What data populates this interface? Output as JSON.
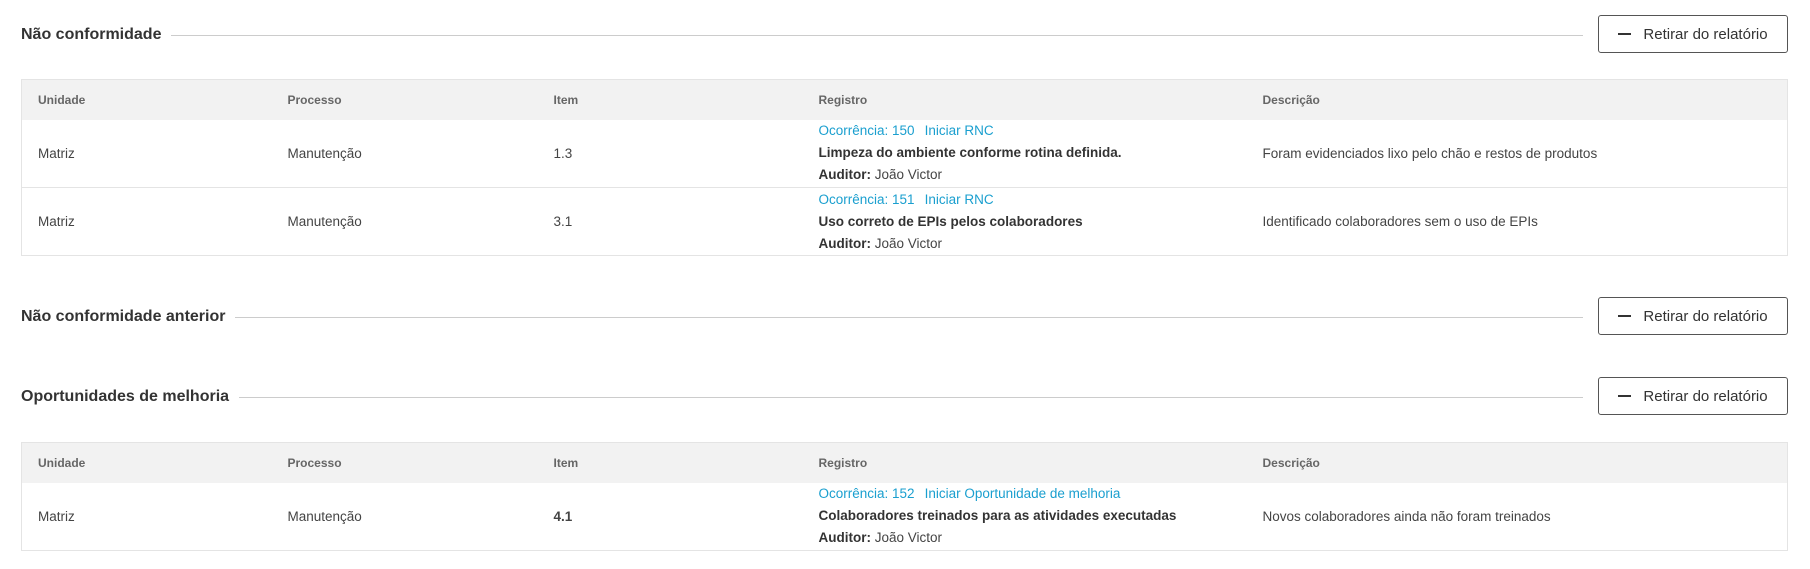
{
  "sections": {
    "nc": {
      "title": "Não conformidade",
      "remove_label": "Retirar do relatório"
    },
    "nc_prev": {
      "title": "Não conformidade anterior",
      "remove_label": "Retirar do relatório"
    },
    "om": {
      "title": "Oportunidades de melhoria",
      "remove_label": "Retirar do relatório"
    }
  },
  "columns": {
    "unidade": "Unidade",
    "processo": "Processo",
    "item": "Item",
    "registro": "Registro",
    "descricao": "Descrição"
  },
  "nc_rows": [
    {
      "unidade": "Matriz",
      "processo": "Manutenção",
      "item": "1.3",
      "occurrence": "Ocorrência: 150",
      "action": "Iniciar RNC",
      "title": "Limpeza do ambiente conforme rotina definida.",
      "auditor_label": "Auditor:",
      "auditor": " João Victor",
      "descricao": "Foram evidenciados lixo pelo chão e restos de produtos"
    },
    {
      "unidade": "Matriz",
      "processo": "Manutenção",
      "item": "3.1",
      "occurrence": "Ocorrência: 151",
      "action": "Iniciar RNC",
      "title": "Uso correto de EPIs pelos colaboradores",
      "auditor_label": "Auditor:",
      "auditor": " João Victor",
      "descricao": "Identificado colaboradores sem o uso de EPIs"
    }
  ],
  "om_rows": [
    {
      "unidade": "Matriz",
      "processo": "Manutenção",
      "item": "4.1",
      "occurrence": "Ocorrência: 152",
      "action": "Iniciar Oportunidade de melhoria",
      "title": "Colaboradores treinados para as atividades executadas",
      "auditor_label": "Auditor:",
      "auditor": " João Victor",
      "descricao": "Novos colaboradores ainda não foram treinados"
    }
  ],
  "colors": {
    "link": "#1a9fcf",
    "header_bg": "#f2f2f2",
    "border": "#e4e4e4"
  },
  "icons": {
    "remove": "minus-icon"
  }
}
